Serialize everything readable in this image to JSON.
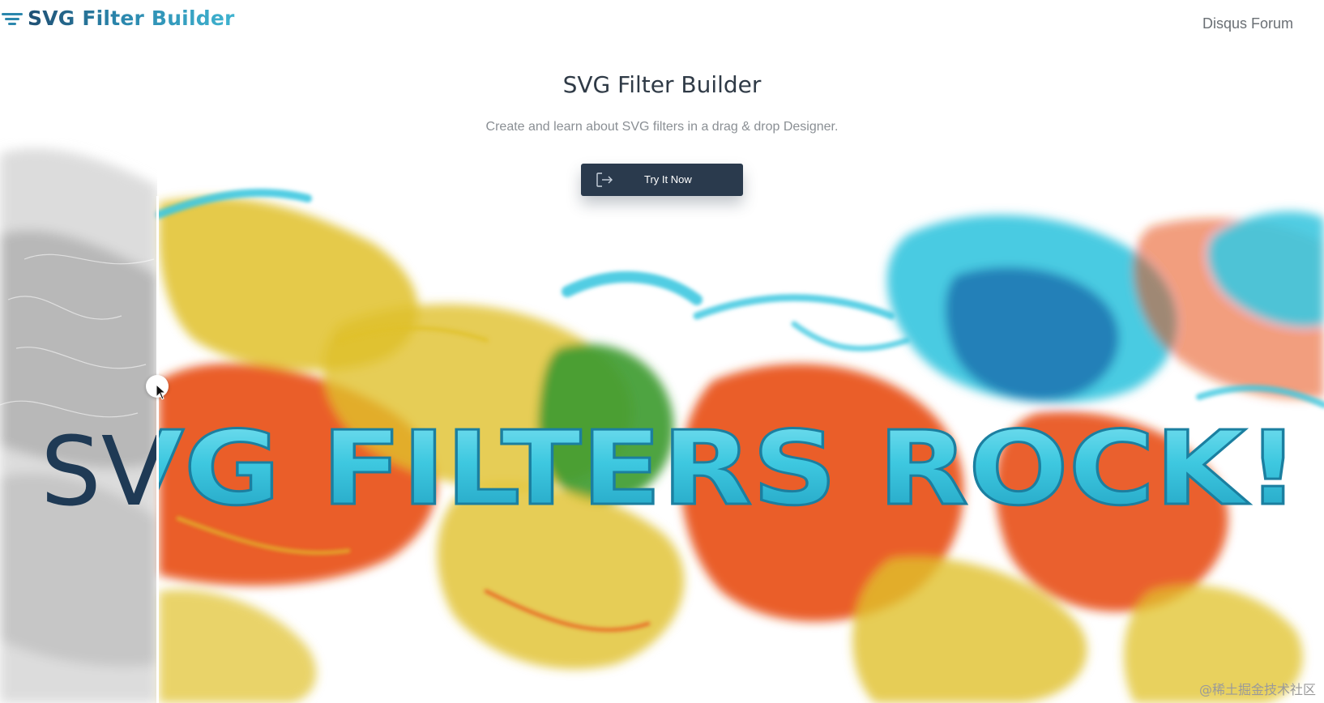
{
  "header": {
    "brand": "SVG Filter Builder",
    "brand_icon": "filter-lines-icon",
    "nav_link": "Disqus Forum"
  },
  "hero": {
    "title": "SVG Filter Builder",
    "subtitle": "Create and learn about SVG filters in a drag & drop Designer.",
    "cta_label": "Try It Now",
    "cta_icon": "sign-in-icon"
  },
  "showcase": {
    "banner_text": "SVG FILTERS ROCK!",
    "before_text": "SV",
    "slider_icon": "compare-slider-handle",
    "colors": {
      "cyan": "#3ec8e0",
      "blue": "#1f78b4",
      "orange": "#e8501a",
      "yellow": "#e0c12a",
      "green": "#3a9a2e",
      "gray": "#b5b5b5"
    }
  },
  "watermark": "@稀土掘金技术社区"
}
